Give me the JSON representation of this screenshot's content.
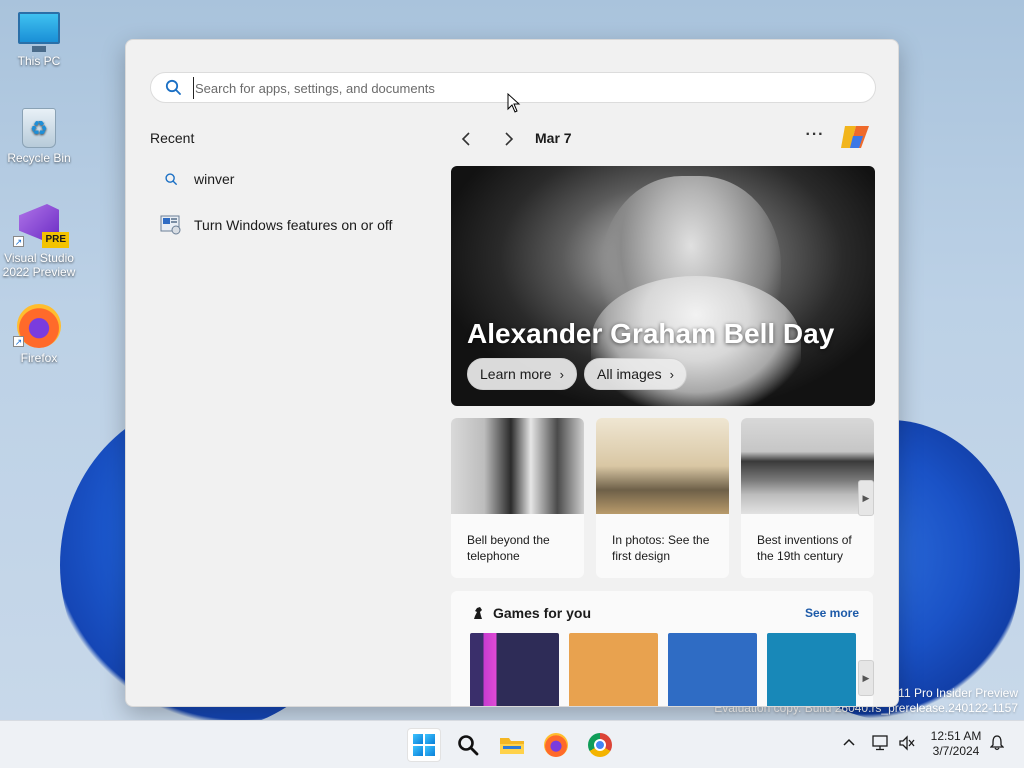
{
  "desktop": {
    "icons": [
      {
        "label": "This PC"
      },
      {
        "label": "Recycle Bin"
      },
      {
        "label": "Visual Studio 2022 Preview",
        "badge": "PRE"
      },
      {
        "label": "Firefox"
      }
    ],
    "watermark": {
      "line1": "11 Pro Insider Preview",
      "line2": "Evaluation copy. Build 26040.rs_prerelease.240122-1157"
    }
  },
  "start": {
    "search": {
      "placeholder": "Search for apps, settings, and documents",
      "value": ""
    },
    "recent": {
      "title": "Recent",
      "items": [
        {
          "label": "winver",
          "icon": "search-icon"
        },
        {
          "label": "Turn Windows features on or off",
          "icon": "windows-features-icon"
        }
      ]
    },
    "feed": {
      "date": "Mar 7",
      "more_label": "···",
      "hero": {
        "title": "Alexander Graham Bell Day",
        "learn_more": "Learn more",
        "all_images": "All images"
      },
      "cards": [
        {
          "caption": "Bell beyond the telephone"
        },
        {
          "caption": "In photos: See the first design"
        },
        {
          "caption": "Best inventions of the 19th century"
        }
      ],
      "games": {
        "title": "Games for you",
        "see_more": "See more",
        "tiles": [
          "#2e2c57",
          "#e8a24f",
          "#2f6cc4",
          "#1888b8"
        ]
      }
    }
  },
  "taskbar": {
    "apps": [
      "start-icon",
      "search-icon",
      "file-explorer-icon",
      "firefox-icon",
      "chrome-icon"
    ],
    "time": "12:51 AM",
    "date": "3/7/2024"
  },
  "colors": {
    "accent": "#0a7fd8",
    "link": "#1d5aa8"
  }
}
